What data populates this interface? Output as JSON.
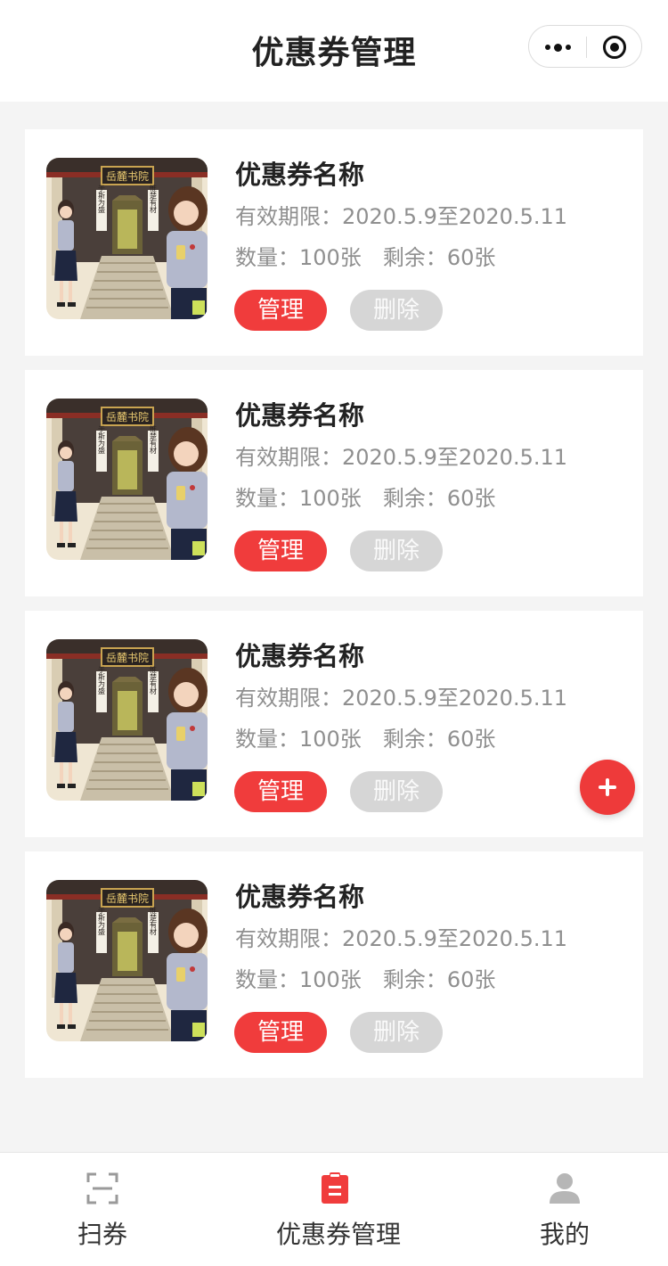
{
  "header": {
    "title": "优惠券管理",
    "more_icon": "more-dots-icon",
    "close_icon": "target-close-icon"
  },
  "coupons": [
    {
      "name": "优惠券名称",
      "period_label": "有效期限：",
      "period_value": "2020.5.9至2020.5.11",
      "qty_label": "数量：",
      "qty_value": "100张",
      "remain_label": "剩余：",
      "remain_value": "60张",
      "manage_label": "管理",
      "delete_label": "删除"
    },
    {
      "name": "优惠券名称",
      "period_label": "有效期限：",
      "period_value": "2020.5.9至2020.5.11",
      "qty_label": "数量：",
      "qty_value": "100张",
      "remain_label": "剩余：",
      "remain_value": "60张",
      "manage_label": "管理",
      "delete_label": "删除"
    },
    {
      "name": "优惠券名称",
      "period_label": "有效期限：",
      "period_value": "2020.5.9至2020.5.11",
      "qty_label": "数量：",
      "qty_value": "100张",
      "remain_label": "剩余：",
      "remain_value": "60张",
      "manage_label": "管理",
      "delete_label": "删除"
    },
    {
      "name": "优惠券名称",
      "period_label": "有效期限：",
      "period_value": "2020.5.9至2020.5.11",
      "qty_label": "数量：",
      "qty_value": "100张",
      "remain_label": "剩余：",
      "remain_value": "60张",
      "manage_label": "管理",
      "delete_label": "删除"
    }
  ],
  "illustration": {
    "plaque_text": "岳麓书院",
    "couplet_left": "于斯为盛",
    "couplet_right": "惟楚有材"
  },
  "fab": {
    "icon": "plus-icon"
  },
  "tabbar": {
    "items": [
      {
        "label": "扫券",
        "icon": "scan-icon",
        "active": false
      },
      {
        "label": "优惠券管理",
        "icon": "clipboard-icon",
        "active": true
      },
      {
        "label": "我的",
        "icon": "user-icon",
        "active": false
      }
    ]
  },
  "colors": {
    "accent": "#f03c3c",
    "disabled": "#d6d6d6",
    "background": "#f4f4f4",
    "muted_text": "#8f8f8f"
  }
}
